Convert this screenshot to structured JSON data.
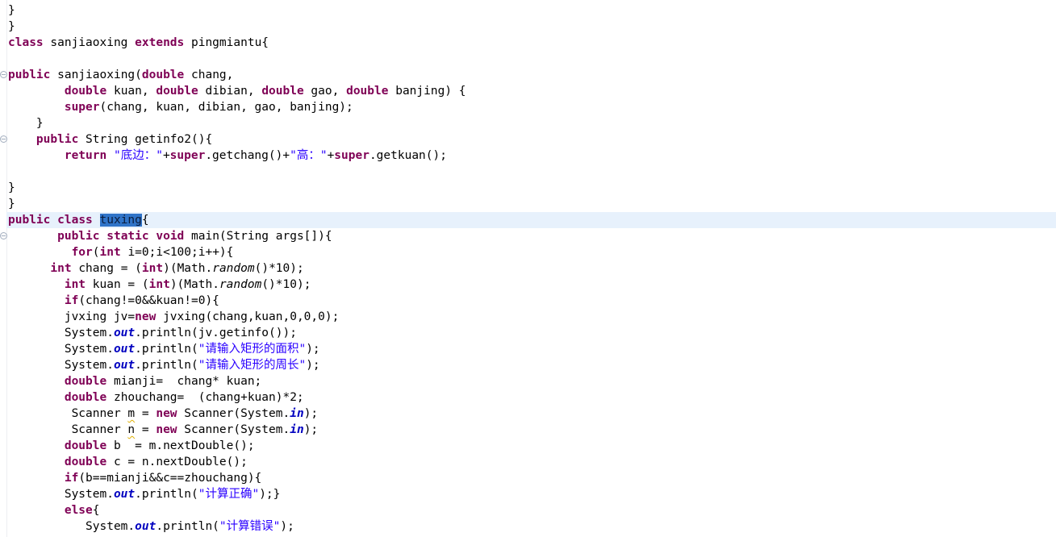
{
  "colors": {
    "keyword": "#7F0055",
    "string": "#2A00FF",
    "static_field": "#0000C0",
    "selection_bg": "#3074C8",
    "selection_fg": "#0A1C3C",
    "current_line_bg": "#E7F1FC",
    "warn_underline": "#E0B000",
    "fold_icon": "#A3AEBF"
  },
  "editor": {
    "selected_text": "tuxing",
    "lines": [
      {
        "segs": [
          {
            "t": "}",
            "c": "p"
          }
        ]
      },
      {
        "segs": [
          {
            "t": "}",
            "c": "p"
          }
        ]
      },
      {
        "segs": [
          {
            "t": "class",
            "c": "k"
          },
          {
            "t": " sanjiaoxing ",
            "c": "p"
          },
          {
            "t": "extends",
            "c": "k"
          },
          {
            "t": " pingmiantu{",
            "c": "p"
          }
        ]
      },
      {
        "segs": []
      },
      {
        "fold": true,
        "segs": [
          {
            "t": "public",
            "c": "k"
          },
          {
            "t": " sanjiaoxing(",
            "c": "p"
          },
          {
            "t": "double",
            "c": "k"
          },
          {
            "t": " chang,",
            "c": "p"
          }
        ]
      },
      {
        "segs": [
          {
            "t": "        ",
            "c": "p"
          },
          {
            "t": "double",
            "c": "k"
          },
          {
            "t": " kuan, ",
            "c": "p"
          },
          {
            "t": "double",
            "c": "k"
          },
          {
            "t": " dibian, ",
            "c": "p"
          },
          {
            "t": "double",
            "c": "k"
          },
          {
            "t": " gao, ",
            "c": "p"
          },
          {
            "t": "double",
            "c": "k"
          },
          {
            "t": " banjing) {",
            "c": "p"
          }
        ]
      },
      {
        "segs": [
          {
            "t": "        ",
            "c": "p"
          },
          {
            "t": "super",
            "c": "k"
          },
          {
            "t": "(chang, kuan, dibian, gao, banjing);",
            "c": "p"
          }
        ]
      },
      {
        "segs": [
          {
            "t": "    }",
            "c": "p"
          }
        ]
      },
      {
        "fold": true,
        "segs": [
          {
            "t": "    ",
            "c": "p"
          },
          {
            "t": "public",
            "c": "k"
          },
          {
            "t": " String getinfo2(){",
            "c": "p"
          }
        ]
      },
      {
        "segs": [
          {
            "t": "        ",
            "c": "p"
          },
          {
            "t": "return",
            "c": "k"
          },
          {
            "t": " ",
            "c": "p"
          },
          {
            "t": "\"底边：\"",
            "c": "s"
          },
          {
            "t": "+",
            "c": "p"
          },
          {
            "t": "super",
            "c": "k"
          },
          {
            "t": ".getchang()+",
            "c": "p"
          },
          {
            "t": "\"高：\"",
            "c": "s"
          },
          {
            "t": "+",
            "c": "p"
          },
          {
            "t": "super",
            "c": "k"
          },
          {
            "t": ".getkuan();",
            "c": "p"
          }
        ]
      },
      {
        "segs": []
      },
      {
        "segs": [
          {
            "t": "}",
            "c": "p"
          }
        ]
      },
      {
        "segs": [
          {
            "t": "}",
            "c": "p"
          }
        ]
      },
      {
        "highlight": true,
        "segs": [
          {
            "t": "public",
            "c": "k"
          },
          {
            "t": " ",
            "c": "p"
          },
          {
            "t": "class",
            "c": "k"
          },
          {
            "t": " ",
            "c": "p"
          },
          {
            "t": "tuxing",
            "c": "sel"
          },
          {
            "t": "{",
            "c": "p"
          }
        ]
      },
      {
        "fold": true,
        "segs": [
          {
            "t": "       ",
            "c": "p"
          },
          {
            "t": "public",
            "c": "k"
          },
          {
            "t": " ",
            "c": "p"
          },
          {
            "t": "static",
            "c": "k"
          },
          {
            "t": " ",
            "c": "p"
          },
          {
            "t": "void",
            "c": "k"
          },
          {
            "t": " main(String args[]){",
            "c": "p"
          }
        ]
      },
      {
        "segs": [
          {
            "t": "         ",
            "c": "p"
          },
          {
            "t": "for",
            "c": "k"
          },
          {
            "t": "(",
            "c": "p"
          },
          {
            "t": "int",
            "c": "k"
          },
          {
            "t": " i=0;i<100;i++){",
            "c": "p"
          }
        ]
      },
      {
        "segs": [
          {
            "t": "      ",
            "c": "p"
          },
          {
            "t": "int",
            "c": "k"
          },
          {
            "t": " chang = (",
            "c": "p"
          },
          {
            "t": "int",
            "c": "k"
          },
          {
            "t": ")(Math.",
            "c": "p"
          },
          {
            "t": "random",
            "c": "m"
          },
          {
            "t": "()*10);",
            "c": "p"
          }
        ]
      },
      {
        "segs": [
          {
            "t": "        ",
            "c": "p"
          },
          {
            "t": "int",
            "c": "k"
          },
          {
            "t": " kuan = (",
            "c": "p"
          },
          {
            "t": "int",
            "c": "k"
          },
          {
            "t": ")(Math.",
            "c": "p"
          },
          {
            "t": "random",
            "c": "m"
          },
          {
            "t": "()*10);",
            "c": "p"
          }
        ]
      },
      {
        "segs": [
          {
            "t": "        ",
            "c": "p"
          },
          {
            "t": "if",
            "c": "k"
          },
          {
            "t": "(chang!=0&&kuan!=0){",
            "c": "p"
          }
        ]
      },
      {
        "segs": [
          {
            "t": "        jvxing jv=",
            "c": "p"
          },
          {
            "t": "new",
            "c": "k"
          },
          {
            "t": " jvxing(chang,kuan,0,0,0);",
            "c": "p"
          }
        ]
      },
      {
        "segs": [
          {
            "t": "        System.",
            "c": "p"
          },
          {
            "t": "out",
            "c": "f"
          },
          {
            "t": ".println(jv.getinfo());",
            "c": "p"
          }
        ]
      },
      {
        "segs": [
          {
            "t": "        System.",
            "c": "p"
          },
          {
            "t": "out",
            "c": "f"
          },
          {
            "t": ".println(",
            "c": "p"
          },
          {
            "t": "\"请输入矩形的面积\"",
            "c": "s"
          },
          {
            "t": ");",
            "c": "p"
          }
        ]
      },
      {
        "segs": [
          {
            "t": "        System.",
            "c": "p"
          },
          {
            "t": "out",
            "c": "f"
          },
          {
            "t": ".println(",
            "c": "p"
          },
          {
            "t": "\"请输入矩形的周长\"",
            "c": "s"
          },
          {
            "t": ");",
            "c": "p"
          }
        ]
      },
      {
        "segs": [
          {
            "t": "        ",
            "c": "p"
          },
          {
            "t": "double",
            "c": "k"
          },
          {
            "t": " mianji=  chang* kuan;",
            "c": "p"
          }
        ]
      },
      {
        "segs": [
          {
            "t": "        ",
            "c": "p"
          },
          {
            "t": "double",
            "c": "k"
          },
          {
            "t": " zhouchang=  (chang+kuan)*2;",
            "c": "p"
          }
        ]
      },
      {
        "segs": [
          {
            "t": "         Scanner ",
            "c": "p"
          },
          {
            "t": "m",
            "c": "w"
          },
          {
            "t": " = ",
            "c": "p"
          },
          {
            "t": "new",
            "c": "k"
          },
          {
            "t": " Scanner(System.",
            "c": "p"
          },
          {
            "t": "in",
            "c": "f"
          },
          {
            "t": ");",
            "c": "p"
          }
        ]
      },
      {
        "segs": [
          {
            "t": "         Scanner ",
            "c": "p"
          },
          {
            "t": "n",
            "c": "w"
          },
          {
            "t": " = ",
            "c": "p"
          },
          {
            "t": "new",
            "c": "k"
          },
          {
            "t": " Scanner(System.",
            "c": "p"
          },
          {
            "t": "in",
            "c": "f"
          },
          {
            "t": ");",
            "c": "p"
          }
        ]
      },
      {
        "segs": [
          {
            "t": "        ",
            "c": "p"
          },
          {
            "t": "double",
            "c": "k"
          },
          {
            "t": " b  = m.nextDouble();",
            "c": "p"
          }
        ]
      },
      {
        "segs": [
          {
            "t": "        ",
            "c": "p"
          },
          {
            "t": "double",
            "c": "k"
          },
          {
            "t": " c = n.nextDouble();",
            "c": "p"
          }
        ]
      },
      {
        "segs": [
          {
            "t": "        ",
            "c": "p"
          },
          {
            "t": "if",
            "c": "k"
          },
          {
            "t": "(b==mianji&&c==zhouchang){",
            "c": "p"
          }
        ]
      },
      {
        "segs": [
          {
            "t": "        System.",
            "c": "p"
          },
          {
            "t": "out",
            "c": "f"
          },
          {
            "t": ".println(",
            "c": "p"
          },
          {
            "t": "\"计算正确\"",
            "c": "s"
          },
          {
            "t": ");}",
            "c": "p"
          }
        ]
      },
      {
        "segs": [
          {
            "t": "        ",
            "c": "p"
          },
          {
            "t": "else",
            "c": "k"
          },
          {
            "t": "{",
            "c": "p"
          }
        ]
      },
      {
        "segs": [
          {
            "t": "           System.",
            "c": "p"
          },
          {
            "t": "out",
            "c": "f"
          },
          {
            "t": ".println(",
            "c": "p"
          },
          {
            "t": "\"计算错误\"",
            "c": "s"
          },
          {
            "t": ");",
            "c": "p"
          }
        ]
      }
    ]
  }
}
